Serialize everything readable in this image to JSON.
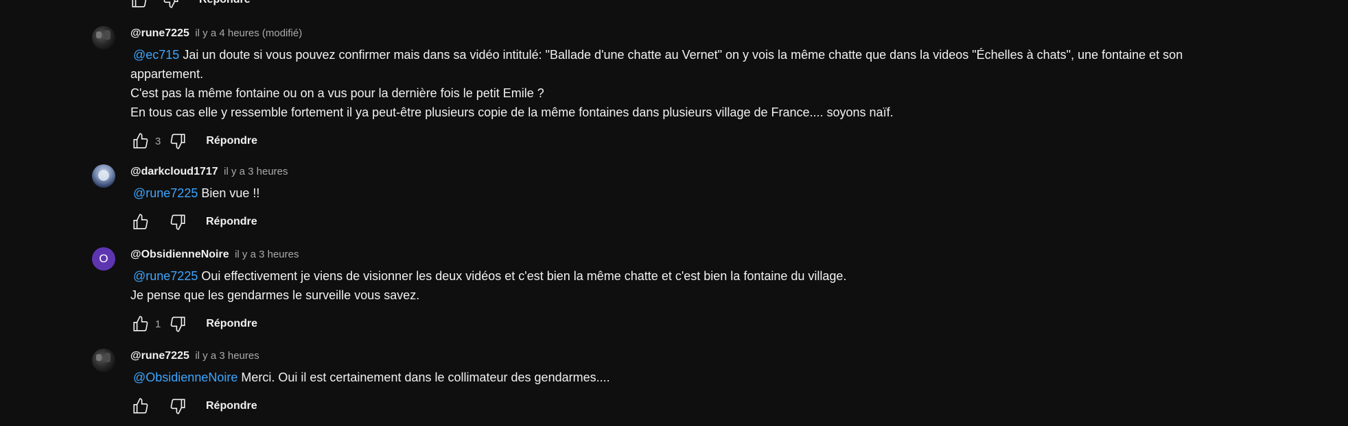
{
  "reply_label": "Répondre",
  "colors": {
    "background": "#0f0f0f",
    "mention": "#3ea6ff",
    "avatar_letter_bg": "#5e35b1"
  },
  "comments": [
    {
      "author": "@rune7225",
      "time": "il y a 4 heures (modifié)",
      "mention": "@ec715",
      "lines": [
        "Jai un doute si vous pouvez confirmer mais dans sa vidéo intitulé: \"Ballade d'une chatte au Vernet\" on y vois la même chatte que dans la videos \"Échelles à chats\", une fontaine et son",
        "appartement.",
        "C'est pas la même fontaine ou on a vus pour la dernière fois le petit Emile ?",
        "En tous cas elle y ressemble fortement il ya peut-être plusieurs copie de la même fontaines dans plusieurs village de France.... soyons naïf."
      ],
      "likes": "3"
    },
    {
      "author": "@darkcloud1717",
      "time": "il y a 3 heures",
      "mention": "@rune7225",
      "lines": [
        "Bien vue !!"
      ],
      "likes": ""
    },
    {
      "author": "@ObsidienneNoire",
      "avatar_letter": "O",
      "time": "il y a 3 heures",
      "mention": "@rune7225",
      "lines": [
        "Oui effectivement je viens de visionner les deux vidéos et c'est bien la même chatte et c'est bien la fontaine du village.",
        "Je pense que les gendarmes le surveille vous savez."
      ],
      "likes": "1"
    },
    {
      "author": "@rune7225",
      "time": "il y a 3 heures",
      "mention": "@ObsidienneNoire",
      "lines": [
        " Merci. Oui il est certainement dans le collimateur des gendarmes...."
      ],
      "likes": ""
    }
  ]
}
